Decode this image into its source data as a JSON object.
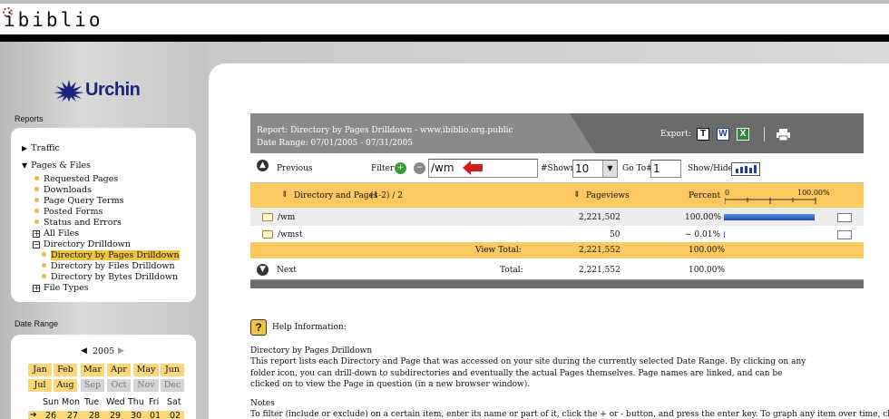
{
  "site": {
    "name": "ibiblio"
  },
  "brand": {
    "name": "Urchin",
    "color": "#1a237e"
  },
  "sidebar": {
    "reports_heading": "Reports",
    "items": [
      {
        "label": "Traffic"
      },
      {
        "label": "Pages & Files"
      },
      {
        "label": "Requested Pages"
      },
      {
        "label": "Downloads"
      },
      {
        "label": "Page Query Terms"
      },
      {
        "label": "Posted Forms"
      },
      {
        "label": "Status and Errors"
      },
      {
        "label": "All Files"
      },
      {
        "label": "Directory Drilldown"
      },
      {
        "label": "Directory by Pages Drilldown"
      },
      {
        "label": "Directory by Files Drilldown"
      },
      {
        "label": "Directory by Bytes Drilldown"
      },
      {
        "label": "File Types"
      }
    ],
    "date_range_heading": "Date Range"
  },
  "calendar": {
    "year": "2005",
    "months": [
      "Jan",
      "Feb",
      "Mar",
      "Apr",
      "May",
      "Jun",
      "Jul",
      "Aug",
      "Sep",
      "Oct",
      "Nov",
      "Dec"
    ],
    "dows": [
      "Sun",
      "Mon",
      "Tue",
      "Wed",
      "Thu",
      "Fri",
      "Sat"
    ],
    "days": [
      "26",
      "27",
      "28",
      "29",
      "30",
      "01",
      "02"
    ]
  },
  "report": {
    "title": "Report: Directory by Pages Drilldown - www.ibiblio.org.public",
    "date_range": "Date Range: 07/01/2005 - 07/31/2005",
    "export_label": "Export:",
    "export_icons": [
      "T",
      "W",
      "X"
    ],
    "previous_label": "Previous",
    "filter_label": "Filter",
    "filter_value": "/wm",
    "shown_label": "#Shown",
    "shown_value": "10",
    "goto_label": "Go To#",
    "goto_value": "1",
    "showhide_label": "Show/Hide",
    "col_dir": "Directory and Pages",
    "col_range": "(1-2) / 2",
    "col_pageviews": "Pageviews",
    "col_percent": "Percent",
    "scale_min": "0",
    "scale_max": "100.00%",
    "rows": [
      {
        "name": "/wm",
        "pageviews": "2,221,502",
        "percent": "100.00%",
        "fraction": 1.0
      },
      {
        "name": "/wmst",
        "pageviews": "50",
        "percent": "~ 0.01%",
        "fraction": 0.0001
      }
    ],
    "view_total_label": "View Total:",
    "view_total_pageviews": "2,221,552",
    "view_total_percent": "100.00%",
    "next_label": "Next",
    "total_label": "Total:",
    "total_pageviews": "2,221,552",
    "total_percent": "100.00%"
  },
  "help": {
    "heading": "Help Information:",
    "title": "Directory by Pages Drilldown",
    "body": "This report lists each Directory and Page that was accessed on your site during the currently selected Date Range. By clicking on any folder icon, you can drill-down to subdirectories and eventually the actual Pages themselves. Page names are linked, and can be clicked on to view the Page in question (in a new browser window).",
    "notes_heading": "Notes",
    "notes_text": "To filter (include or exclude) on a certain item, enter its name or part of it, click the + or - button, and press the enter key. To graph any item over time, click the"
  }
}
